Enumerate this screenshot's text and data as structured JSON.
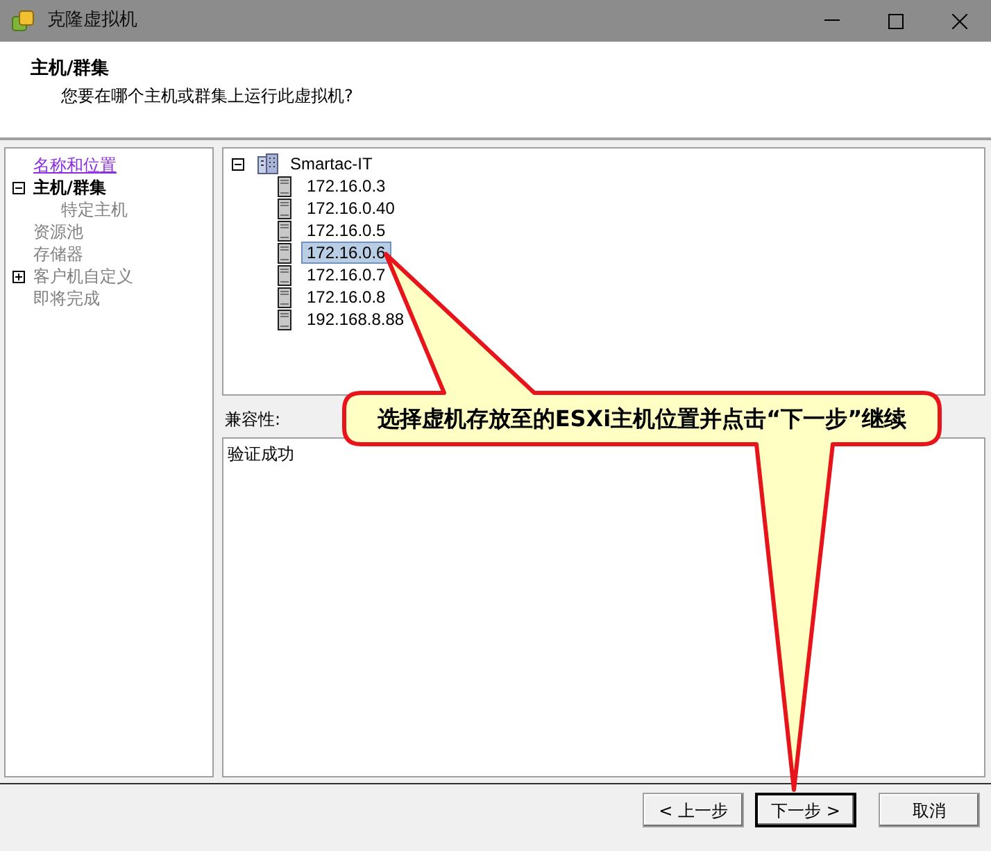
{
  "window": {
    "title": "克隆虚拟机"
  },
  "header": {
    "title": "主机/群集",
    "subtitle": "您要在哪个主机或群集上运行此虚拟机?"
  },
  "wizard_steps": [
    {
      "label": "名称和位置",
      "kind": "plain",
      "visited": true,
      "current": false
    },
    {
      "label": "主机/群集",
      "kind": "toggle",
      "expanded": true,
      "visited": false,
      "current": true,
      "children": [
        {
          "label": "特定主机",
          "kind": "plain",
          "visited": false,
          "current": false
        }
      ]
    },
    {
      "label": "资源池",
      "kind": "plain",
      "visited": false,
      "current": false
    },
    {
      "label": "存储器",
      "kind": "plain",
      "visited": false,
      "current": false
    },
    {
      "label": "客户机自定义",
      "kind": "toggle",
      "expanded": false,
      "visited": false,
      "current": false
    },
    {
      "label": "即将完成",
      "kind": "plain",
      "visited": false,
      "current": false
    }
  ],
  "host_tree": {
    "label": "Smartac-IT",
    "expanded": true,
    "selected": false,
    "children": [
      {
        "label": "172.16.0.3",
        "selected": false
      },
      {
        "label": "172.16.0.40",
        "selected": false
      },
      {
        "label": "172.16.0.5",
        "selected": false
      },
      {
        "label": "172.16.0.6",
        "selected": true
      },
      {
        "label": "172.16.0.7",
        "selected": false
      },
      {
        "label": "172.16.0.8",
        "selected": false
      },
      {
        "label": "192.168.8.88",
        "selected": false
      }
    ]
  },
  "compatibility": {
    "label": "兼容性:",
    "message": "验证成功"
  },
  "buttons": [
    {
      "label": "< 上一步",
      "kind": "back",
      "focused": false
    },
    {
      "label": "下一步 >",
      "kind": "next",
      "focused": true
    },
    {
      "label": "取消",
      "kind": "cancel",
      "focused": false
    }
  ],
  "callout": {
    "text": "选择虚机存放至的ESXi主机位置并点击“下一步”继续"
  }
}
